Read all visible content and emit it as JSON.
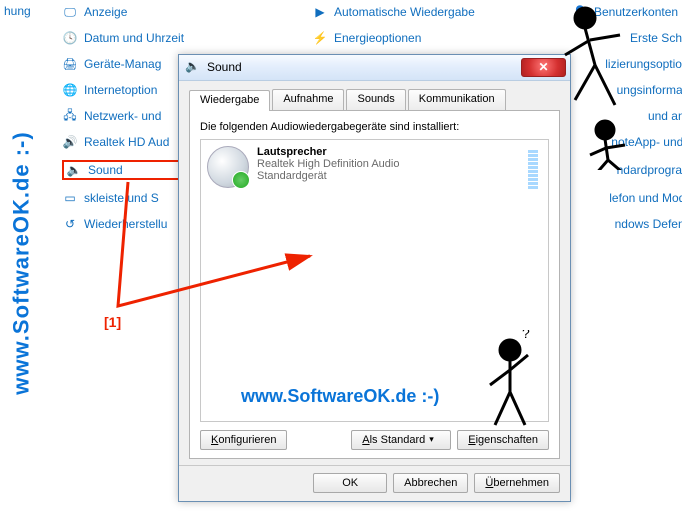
{
  "watermark_left": "www.SoftwareOK.de :-)",
  "watermark_inside": "www.SoftwareOK.de :-)",
  "callout": "[1]",
  "cp": {
    "left_trunc": "hung",
    "items": [
      {
        "label": "Anzeige",
        "icon": "display-icon"
      },
      {
        "label": "Automatische Wiedergabe",
        "icon": "autoplay-icon"
      },
      {
        "label": "Benutzerkonten",
        "icon": "user-icon"
      },
      {
        "label": "Datum und Uhrzeit",
        "icon": "clock-icon"
      },
      {
        "label": "Energieoptionen",
        "icon": "power-icon"
      },
      {
        "label": "Erste Schritte",
        "icon": "flag-icon"
      },
      {
        "label": "Geräte-Manager",
        "icon": "device-manager-icon",
        "trunc_label": "Geräte-Manag"
      },
      {
        "label": "",
        "icon": "",
        "trunc_right": "lizierungsoptionen"
      },
      {
        "label": "",
        "icon": "",
        "trunc_right": ""
      },
      {
        "label": "Internetoption",
        "icon": "globe-icon",
        "trunc_label": "Internetoption"
      },
      {
        "label": "",
        "icon": ""
      },
      {
        "label": "",
        "icon": "",
        "trunc_right": "ungsinformation"
      },
      {
        "label": "Netzwerk- und",
        "icon": "network-icon",
        "trunc_label": "Netzwerk- und"
      },
      {
        "label": "",
        "icon": ""
      },
      {
        "label": "",
        "icon": "",
        "trunc_right": "und ander"
      },
      {
        "label": "Realtek HD Aud",
        "icon": "audio-icon",
        "trunc_label": "Realtek HD Aud"
      },
      {
        "label": "",
        "icon": ""
      },
      {
        "label": "",
        "icon": "",
        "trunc_right": "noteApp- und De"
      },
      {
        "label": "Sound",
        "icon": "speaker-icon",
        "highlight": true
      },
      {
        "label": "",
        "icon": ""
      },
      {
        "label": "",
        "icon": "",
        "trunc_right": "ndardprogramm"
      },
      {
        "label": "skleiste und S",
        "icon": "taskbar-icon",
        "trunc_label": "skleiste und S"
      },
      {
        "label": "",
        "icon": ""
      },
      {
        "label": "",
        "icon": "",
        "trunc_right": "lefon und Modem"
      },
      {
        "label": "Wiederherstellu",
        "icon": "recovery-icon",
        "trunc_label": "Wiederherstellu"
      },
      {
        "label": "",
        "icon": ""
      },
      {
        "label": "",
        "icon": "",
        "trunc_right": "ndows Defender"
      }
    ]
  },
  "dialog": {
    "title": "Sound",
    "close_x": "✕",
    "tabs": [
      {
        "label": "Wiedergabe",
        "active": true
      },
      {
        "label": "Aufnahme"
      },
      {
        "label": "Sounds"
      },
      {
        "label": "Kommunikation"
      }
    ],
    "pane_caption": "Die folgenden Audiowiedergabegeräte sind installiert:",
    "device": {
      "name": "Lautsprecher",
      "driver": "Realtek High Definition Audio",
      "status": "Standardgerät"
    },
    "btn_configure": "Konfigurieren",
    "btn_configure_u": "K",
    "btn_default": "Als Standard",
    "btn_default_u": "A",
    "btn_props": "Eigenschaften",
    "btn_props_u": "E",
    "footer_ok": "OK",
    "footer_cancel": "Abbrechen",
    "footer_apply": "Übernehmen",
    "footer_apply_u": "Ü"
  }
}
